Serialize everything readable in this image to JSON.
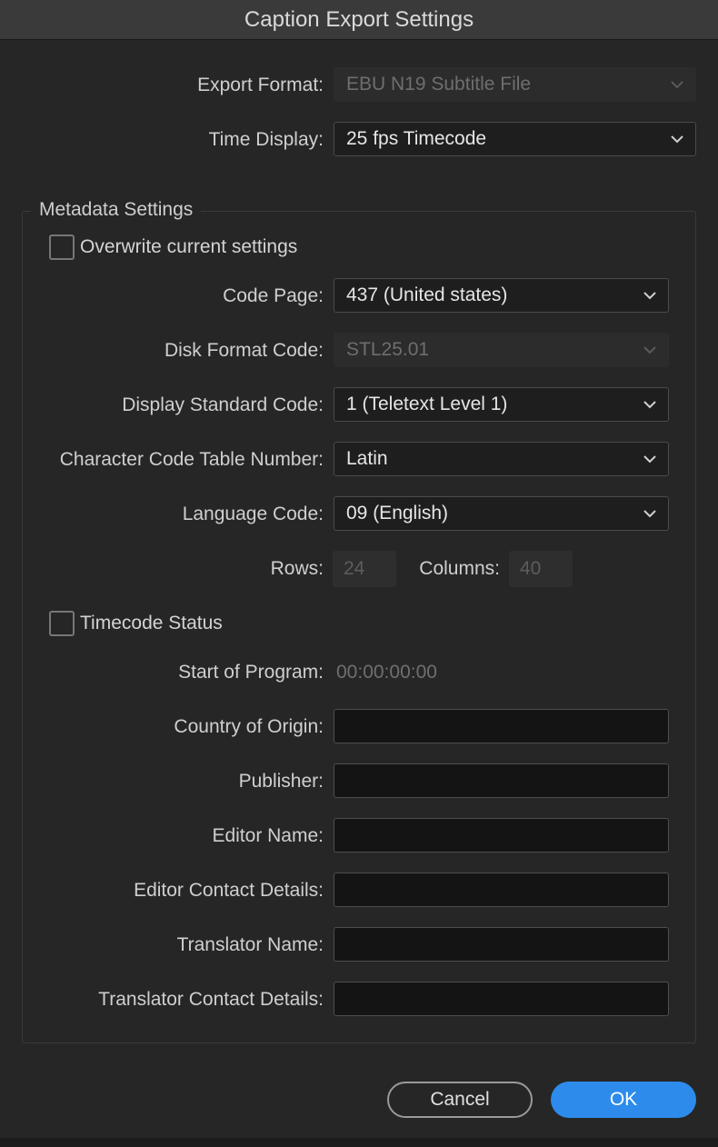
{
  "window": {
    "title": "Caption Export Settings"
  },
  "export_format": {
    "label": "Export Format:",
    "value": "EBU N19 Subtitle File"
  },
  "time_display": {
    "label": "Time Display:",
    "value": "25 fps Timecode"
  },
  "metadata": {
    "legend": "Metadata Settings",
    "overwrite_label": "Overwrite current settings",
    "code_page": {
      "label": "Code Page:",
      "value": "437 (United states)"
    },
    "disk_format_code": {
      "label": "Disk Format Code:",
      "value": "STL25.01"
    },
    "display_standard_code": {
      "label": "Display Standard Code:",
      "value": "1 (Teletext Level 1)"
    },
    "character_code_table": {
      "label": "Character Code Table Number:",
      "value": "Latin"
    },
    "language_code": {
      "label": "Language Code:",
      "value": "09 (English)"
    },
    "rows": {
      "label": "Rows:",
      "value": "24"
    },
    "columns": {
      "label": "Columns:",
      "value": "40"
    },
    "timecode_status_label": "Timecode Status",
    "start_of_program": {
      "label": "Start of Program:",
      "value": "00:00:00:00"
    },
    "country_of_origin": {
      "label": "Country of Origin:",
      "value": ""
    },
    "publisher": {
      "label": "Publisher:",
      "value": ""
    },
    "editor_name": {
      "label": "Editor Name:",
      "value": ""
    },
    "editor_contact": {
      "label": "Editor Contact Details:",
      "value": ""
    },
    "translator_name": {
      "label": "Translator Name:",
      "value": ""
    },
    "translator_contact": {
      "label": "Translator Contact Details:",
      "value": ""
    }
  },
  "buttons": {
    "cancel": "Cancel",
    "ok": "OK"
  },
  "colors": {
    "accent": "#2d8ceb",
    "background": "#262626",
    "titlebar": "#3a3a3a"
  }
}
